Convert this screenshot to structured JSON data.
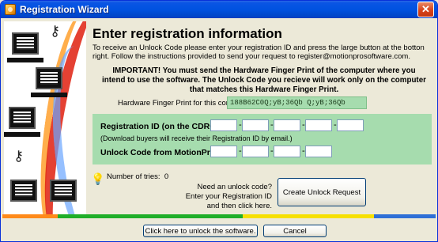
{
  "window": {
    "title": "Registration Wizard"
  },
  "heading": "Enter registration information",
  "intro": "To receive an Unlock Code please enter your registration ID and press the large button at the botton right. Follow the instructions provided to send your request to register@motionprosoftware.com.",
  "important": "IMPORTANT! You must send the Hardware Finger Print of the computer where you intend to use the software. The Unlock Code you recieve will work only on the computer that matches this Hardware Finger Print.",
  "fingerprint": {
    "label": "Hardware Finger Print for this computer:",
    "value": "188B62C0Q;yB;36Qb Q;yB;36Qb"
  },
  "registration": {
    "label": "Registration ID (on the CDROM):",
    "note": "(Download buyers will receive their Registration ID by email.)",
    "segments": [
      "",
      "",
      "",
      "",
      ""
    ]
  },
  "unlock": {
    "label": "Unlock Code from MotionPro:",
    "segments": [
      "",
      "",
      "",
      ""
    ]
  },
  "tries": {
    "label": "Number of tries:",
    "value": "0"
  },
  "need_unlock": "Need an unlock code? Enter your Registration ID and then click here.",
  "buttons": {
    "create_request": "Create Unlock Request",
    "unlock": "Click here to unlock the software.",
    "cancel": "Cancel"
  },
  "progress_colors": [
    "#ff8a1a",
    "#1fae28",
    "#f6e000",
    "#2e6fd6"
  ],
  "icons": {
    "app": "wizard-icon",
    "close": "close-icon",
    "tries": "lightbulb-icon"
  }
}
